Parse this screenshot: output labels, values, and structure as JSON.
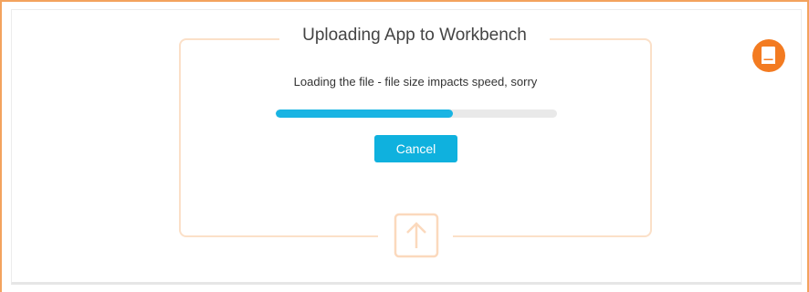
{
  "dialog": {
    "title": "Uploading App to Workbench",
    "message": "Loading the file - file size impacts speed, sorry",
    "progress_percent": 63,
    "cancel_label": "Cancel"
  },
  "icons": {
    "upload": "upload-arrow-icon",
    "docs": "document-icon"
  },
  "colors": {
    "frame_border": "#f3a35e",
    "accent": "#0fb1de",
    "progress_fill": "#19b4e3",
    "dropzone_border": "#fbe0c8",
    "doc_badge": "#f37b21"
  }
}
